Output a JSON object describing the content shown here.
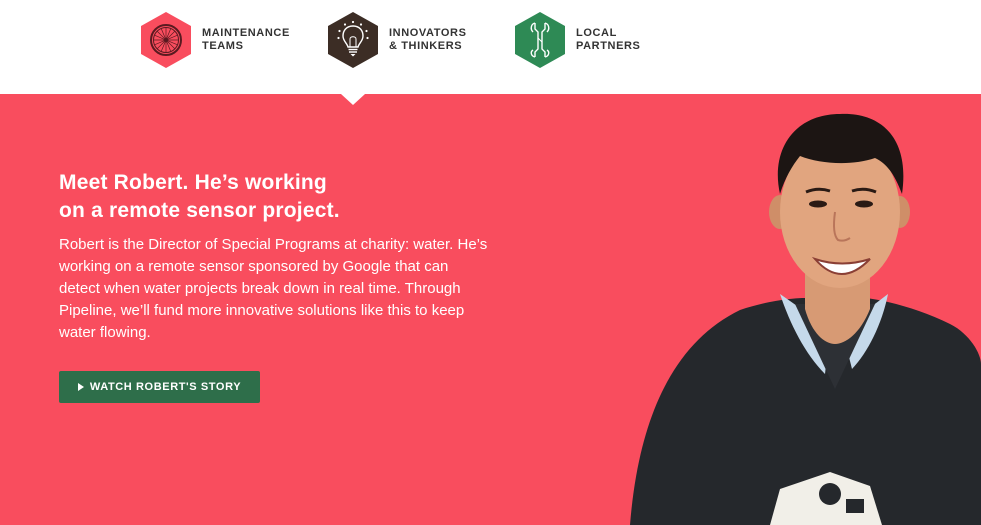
{
  "tabs": [
    {
      "line1": "Maintenance",
      "line2": "Teams",
      "icon": "bicycle-wheel-icon",
      "color": "#f94d5e"
    },
    {
      "line1": "Innovators",
      "line2": "& Thinkers",
      "icon": "lightbulb-icon",
      "color": "#3c2d25"
    },
    {
      "line1": "Local",
      "line2": "Partners",
      "icon": "wrench-icon",
      "color": "#2e8a55"
    }
  ],
  "hero": {
    "background": "#f94d5e",
    "headline_line1": "Meet Robert. He’s working",
    "headline_line2": "on a remote sensor project.",
    "body": "Robert is the Director of Special Programs at charity: water. He’s working on a remote sensor sponsored by Google that can detect when water projects break down in real time. Through Pipeline, we’ll fund more innovative solutions like this to keep water flowing.",
    "cta_label": "Watch Robert's Story",
    "cta_color": "#2e6e4a"
  }
}
